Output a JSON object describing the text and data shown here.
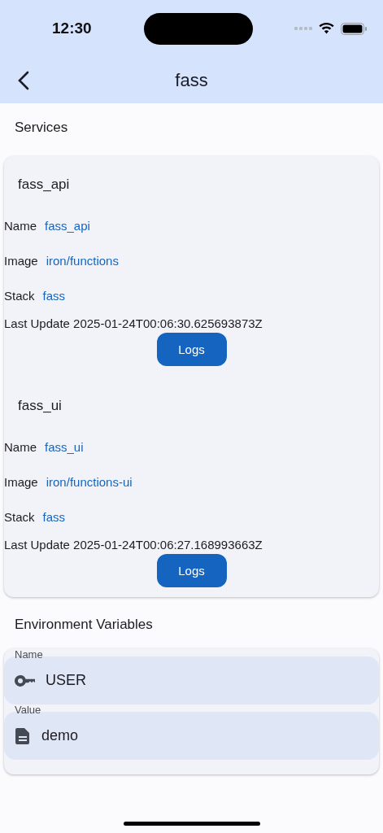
{
  "status_bar": {
    "time": "12:30"
  },
  "app_bar": {
    "title": "fass"
  },
  "services_heading": "Services",
  "services": [
    {
      "title": "fass_api",
      "fields": [
        {
          "label": "Name",
          "value": "fass_api"
        },
        {
          "label": "Image",
          "value": "iron/functions"
        },
        {
          "label": "Stack",
          "value": "fass"
        }
      ],
      "last_update": "Last Update 2025-01-24T00:06:30.625693873Z",
      "button": "Logs"
    },
    {
      "title": "fass_ui",
      "fields": [
        {
          "label": "Name",
          "value": "fass_ui"
        },
        {
          "label": "Image",
          "value": "iron/functions-ui"
        },
        {
          "label": "Stack",
          "value": "fass"
        }
      ],
      "last_update": "Last Update 2025-01-24T00:06:27.168993663Z",
      "button": "Logs"
    }
  ],
  "env_heading": "Environment Variables",
  "env_fields": [
    {
      "kind": "key",
      "label": "Name",
      "value": "USER"
    },
    {
      "kind": "document",
      "label": "Value",
      "value": "demo"
    }
  ]
}
